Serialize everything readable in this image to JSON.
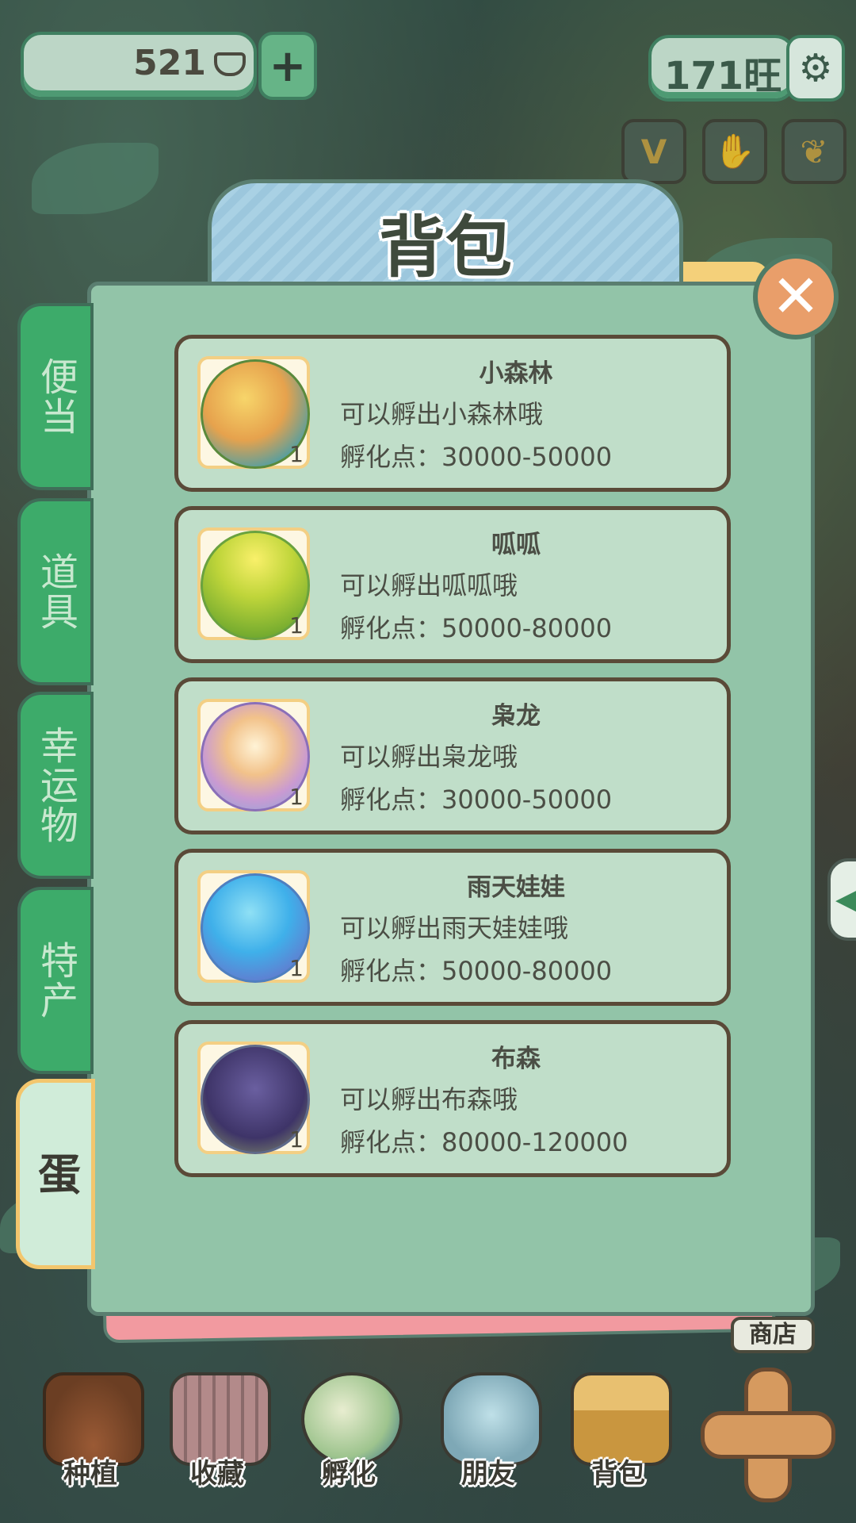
{
  "top_bar": {
    "coins": "521",
    "plus_label": "+",
    "wang": "171旺"
  },
  "side_icons": [
    {
      "name": "v-badge-icon",
      "label": "V"
    },
    {
      "name": "hand-icon",
      "label": "✋"
    },
    {
      "name": "ginkgo-leaf-icon",
      "label": "🍂"
    }
  ],
  "panel": {
    "title": "背包",
    "close_label": "✕"
  },
  "tabs": [
    {
      "label": "便当",
      "active": false
    },
    {
      "label": "道具",
      "active": false
    },
    {
      "label": "幸运物",
      "active": false
    },
    {
      "label": "特产",
      "active": false
    },
    {
      "label": "蛋",
      "active": true
    }
  ],
  "items": [
    {
      "name": "小森林",
      "desc": "可以孵出小森林哦",
      "points": "孵化点：30000-50000",
      "count": "1",
      "icon": "forest-egg-icon",
      "color": "#e6b36a"
    },
    {
      "name": "呱呱",
      "desc": "可以孵出呱呱哦",
      "points": "孵化点：50000-80000",
      "count": "1",
      "icon": "frog-egg-icon",
      "color": "#a9cf3c"
    },
    {
      "name": "枭龙",
      "desc": "可以孵出枭龙哦",
      "points": "孵化点：30000-50000",
      "count": "1",
      "icon": "dragon-egg-icon",
      "color": "#d9a8c9"
    },
    {
      "name": "雨天娃娃",
      "desc": "可以孵出雨天娃娃哦",
      "points": "孵化点：50000-80000",
      "count": "1",
      "icon": "rain-egg-icon",
      "color": "#4fb6e8"
    },
    {
      "name": "布森",
      "desc": "可以孵出布森哦",
      "points": "孵化点：80000-120000",
      "count": "1",
      "icon": "dark-egg-icon",
      "color": "#5a4f86"
    }
  ],
  "shop_label": "商店",
  "nav": [
    {
      "label": "种植",
      "icon": "plant-icon"
    },
    {
      "label": "收藏",
      "icon": "collection-book-icon"
    },
    {
      "label": "孵化",
      "icon": "hatch-egg-icon"
    },
    {
      "label": "朋友",
      "icon": "cat-friend-icon"
    },
    {
      "label": "背包",
      "icon": "basket-bag-icon"
    }
  ]
}
